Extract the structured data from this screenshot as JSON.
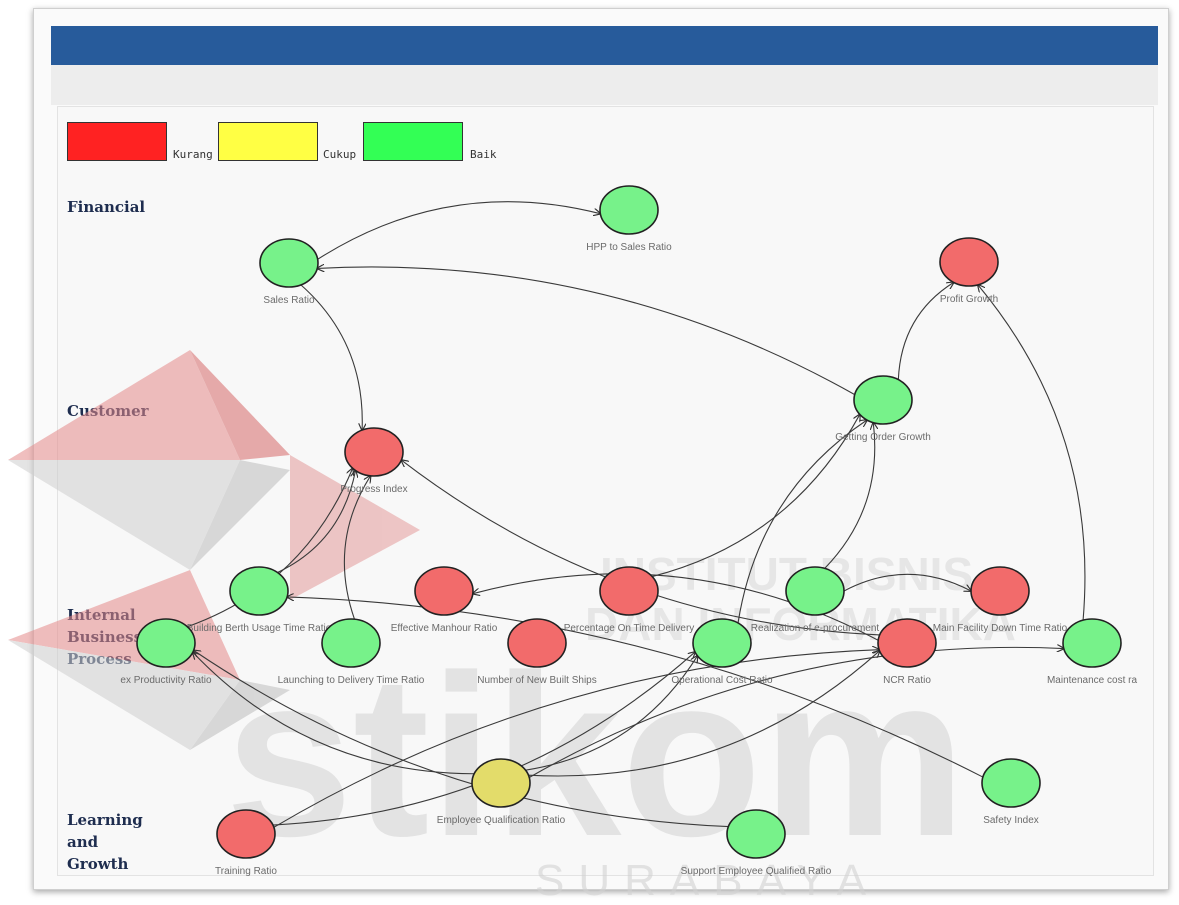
{
  "legend": [
    {
      "label": "Kurang",
      "color": "#ff2222"
    },
    {
      "label": "Cukup",
      "color": "#ffff44"
    },
    {
      "label": "Baik",
      "color": "#33ff55"
    }
  ],
  "perspectives": {
    "financial": "Financial",
    "customer": "Customer",
    "internal": "Internal\nBusiness\nProcess",
    "learning": "Learning\nand\nGrowth"
  },
  "status_colors": {
    "kurang": "#f26b6b",
    "cukup": "#e3dc6a",
    "baik": "#77f28a"
  },
  "nodes": [
    {
      "id": "hpp",
      "label": "HPP to Sales Ratio",
      "status": "baik"
    },
    {
      "id": "sales",
      "label": "Sales Ratio",
      "status": "baik"
    },
    {
      "id": "profit",
      "label": "Profit Growth",
      "status": "kurang"
    },
    {
      "id": "order",
      "label": "Getting Order Growth",
      "status": "baik"
    },
    {
      "id": "progress",
      "label": "Progress Index",
      "status": "kurang"
    },
    {
      "id": "berth",
      "label": "Building Berth Usage Time Ratio",
      "status": "baik"
    },
    {
      "id": "manhour",
      "label": "Effective Manhour Ratio",
      "status": "kurang"
    },
    {
      "id": "delivery",
      "label": "Percentage On Time Delivery",
      "status": "kurang"
    },
    {
      "id": "eproc",
      "label": "Realization of e-procurement",
      "status": "baik"
    },
    {
      "id": "facility",
      "label": "Main Facility Down Time Ratio",
      "status": "kurang"
    },
    {
      "id": "index",
      "label": "ex Productivity Ratio",
      "status": "baik"
    },
    {
      "id": "launch",
      "label": "Launching to Delivery Time Ratio",
      "status": "baik"
    },
    {
      "id": "ships",
      "label": "Number of New Built Ships",
      "status": "kurang"
    },
    {
      "id": "opcost",
      "label": "Operational Cost Ratio",
      "status": "baik"
    },
    {
      "id": "ncr",
      "label": "NCR Ratio",
      "status": "kurang"
    },
    {
      "id": "maint",
      "label": "Maintenance cost ra",
      "status": "baik"
    },
    {
      "id": "eqr",
      "label": "Employee Qualification Ratio",
      "status": "cukup"
    },
    {
      "id": "safety",
      "label": "Safety Index",
      "status": "baik"
    },
    {
      "id": "training",
      "label": "Training Ratio",
      "status": "kurang"
    },
    {
      "id": "support",
      "label": "Support Employee Qualified Ratio",
      "status": "baik"
    }
  ],
  "links": [
    [
      "sales",
      "hpp"
    ],
    [
      "order",
      "sales"
    ],
    [
      "order",
      "profit"
    ],
    [
      "maint",
      "profit"
    ],
    [
      "sales",
      "progress"
    ],
    [
      "berth",
      "progress"
    ],
    [
      "launch",
      "progress"
    ],
    [
      "index",
      "progress"
    ],
    [
      "ncr",
      "progress"
    ],
    [
      "delivery",
      "order"
    ],
    [
      "opcost",
      "order"
    ],
    [
      "eproc",
      "order"
    ],
    [
      "eproc",
      "facility"
    ],
    [
      "ncr",
      "manhour"
    ],
    [
      "eqr",
      "index"
    ],
    [
      "eqr",
      "ncr"
    ],
    [
      "eqr",
      "maint"
    ],
    [
      "eqr",
      "opcost"
    ],
    [
      "training",
      "ncr"
    ],
    [
      "training",
      "opcost"
    ],
    [
      "support",
      "index"
    ],
    [
      "safety",
      "berth"
    ]
  ],
  "watermark": {
    "brand": "stikom",
    "institute_line1": "INSTITUT BISNIS",
    "institute_line2": "DAN INFORMATIKA",
    "city": "SURABAYA"
  }
}
